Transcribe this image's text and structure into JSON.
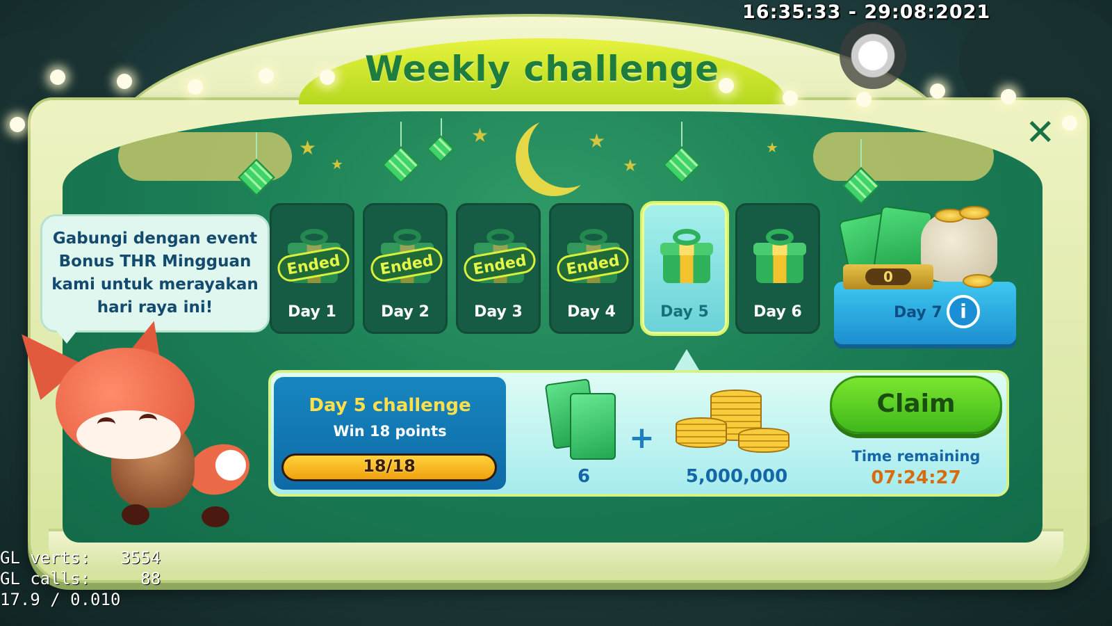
{
  "overlay": {
    "timestamp": "16:35:33 - 29:08:2021",
    "debug_lines": [
      "GL verts:   3554",
      "GL calls:     88",
      "17.9 / 0.010"
    ]
  },
  "header": {
    "title": "Weekly challenge",
    "close_icon": "close-icon"
  },
  "speech": {
    "text": "Gabungi dengan event Bonus THR Mingguan kami untuk merayakan hari raya ini!"
  },
  "days": [
    {
      "label": "Day 1",
      "status": "Ended"
    },
    {
      "label": "Day 2",
      "status": "Ended"
    },
    {
      "label": "Day 3",
      "status": "Ended"
    },
    {
      "label": "Day 4",
      "status": "Ended"
    },
    {
      "label": "Day 5",
      "status": "active"
    },
    {
      "label": "Day 6",
      "status": "locked"
    }
  ],
  "day7": {
    "label": "Day 7",
    "count": "0",
    "info_icon": "info-icon"
  },
  "challenge": {
    "title": "Day 5 challenge",
    "subtitle": "Win 18 points",
    "progress_text": "18/18",
    "progress_fraction": 1.0
  },
  "rewards": {
    "envelope_count": "6",
    "coins_amount": "5,000,000"
  },
  "claim": {
    "button_label": "Claim",
    "time_label": "Time remaining",
    "time_value": "07:24:27"
  },
  "colors": {
    "accent_green": "#3fb81a",
    "title_green": "#1e7c3e",
    "panel_blue": "#1786c0",
    "timer_orange": "#d66b10"
  }
}
